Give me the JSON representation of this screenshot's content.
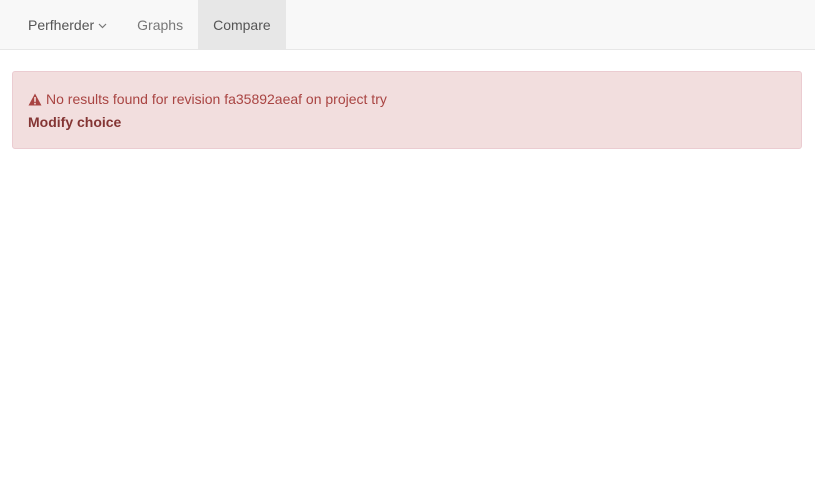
{
  "navbar": {
    "brand_label": "Perfherder",
    "items": [
      {
        "label": "Graphs",
        "active": false
      },
      {
        "label": "Compare",
        "active": true
      }
    ]
  },
  "alert": {
    "message": "No results found for revision fa35892aeaf on project try",
    "link_label": "Modify choice",
    "icon": "warning-icon"
  },
  "colors": {
    "alert_background": "#f2dede",
    "alert_text": "#a94442",
    "navbar_background": "#f8f8f8",
    "active_tab": "#e7e7e7"
  }
}
